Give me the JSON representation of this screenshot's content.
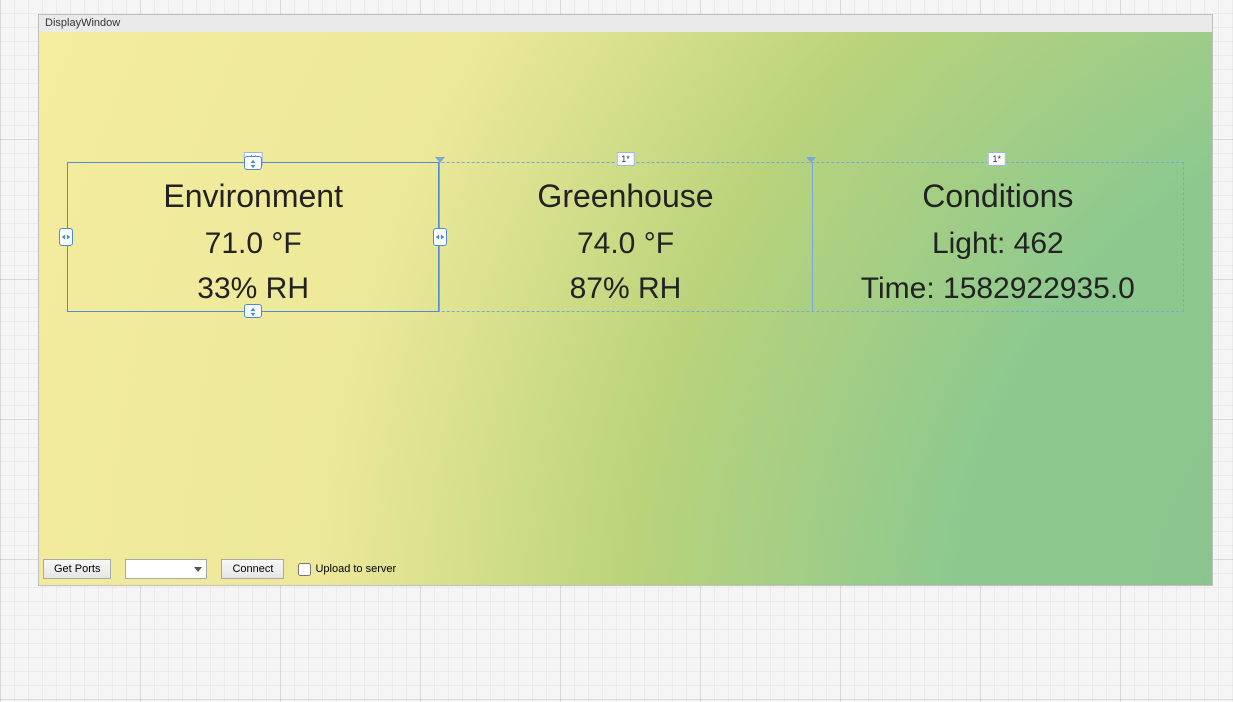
{
  "window": {
    "title": "DisplayWindow"
  },
  "grid": {
    "col1_tag": "1*",
    "col2_tag": "1*",
    "col3_tag": "1*"
  },
  "panels": {
    "environment": {
      "title": "Environment",
      "temp": "71.0 °F",
      "humidity": "33% RH"
    },
    "greenhouse": {
      "title": "Greenhouse",
      "temp": "74.0 °F",
      "humidity": "87% RH"
    },
    "conditions": {
      "title": "Conditions",
      "light": "Light: 462",
      "time": "Time: 1582922935.0"
    }
  },
  "controls": {
    "get_ports": "Get Ports",
    "port_selected": "",
    "connect": "Connect",
    "upload_label": "Upload to server"
  }
}
